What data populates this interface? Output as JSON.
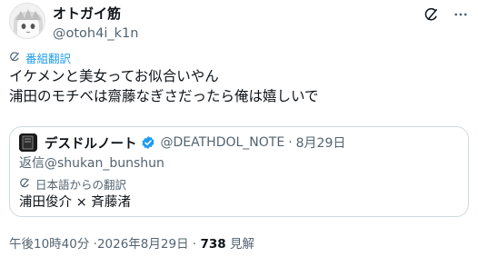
{
  "author": {
    "display_name": "オトガイ筋",
    "handle": "@otoh4i_k1n"
  },
  "tweet": {
    "translated_label": "番組翻訳",
    "lines": [
      "イケメンと美女ってお似合いやん",
      "浦田のモチベは齋藤なぎさだったら俺は嬉しいで"
    ]
  },
  "quote": {
    "display_name": "デスドルノート",
    "handle": "@DEATHDOL_NOTE",
    "separator": "·",
    "date": "8月29日",
    "reply_prefix": "返信",
    "reply_to": "@shukan_bunshun",
    "translated_label": "日本語からの翻訳",
    "text": "浦田俊介 × 斉藤渚"
  },
  "footer": {
    "time": "午後10時40分",
    "separator1": "·",
    "date": "2026年8月29日",
    "separator2": "·",
    "views_count": "738",
    "views_label": "見解"
  },
  "colors": {
    "accent": "#1d9bf0",
    "text_primary": "#0f1419",
    "text_secondary": "#536471",
    "border": "#cfd9de"
  },
  "icons": [
    "grok-icon",
    "more-icon",
    "translate-icon",
    "verified-badge-icon"
  ]
}
